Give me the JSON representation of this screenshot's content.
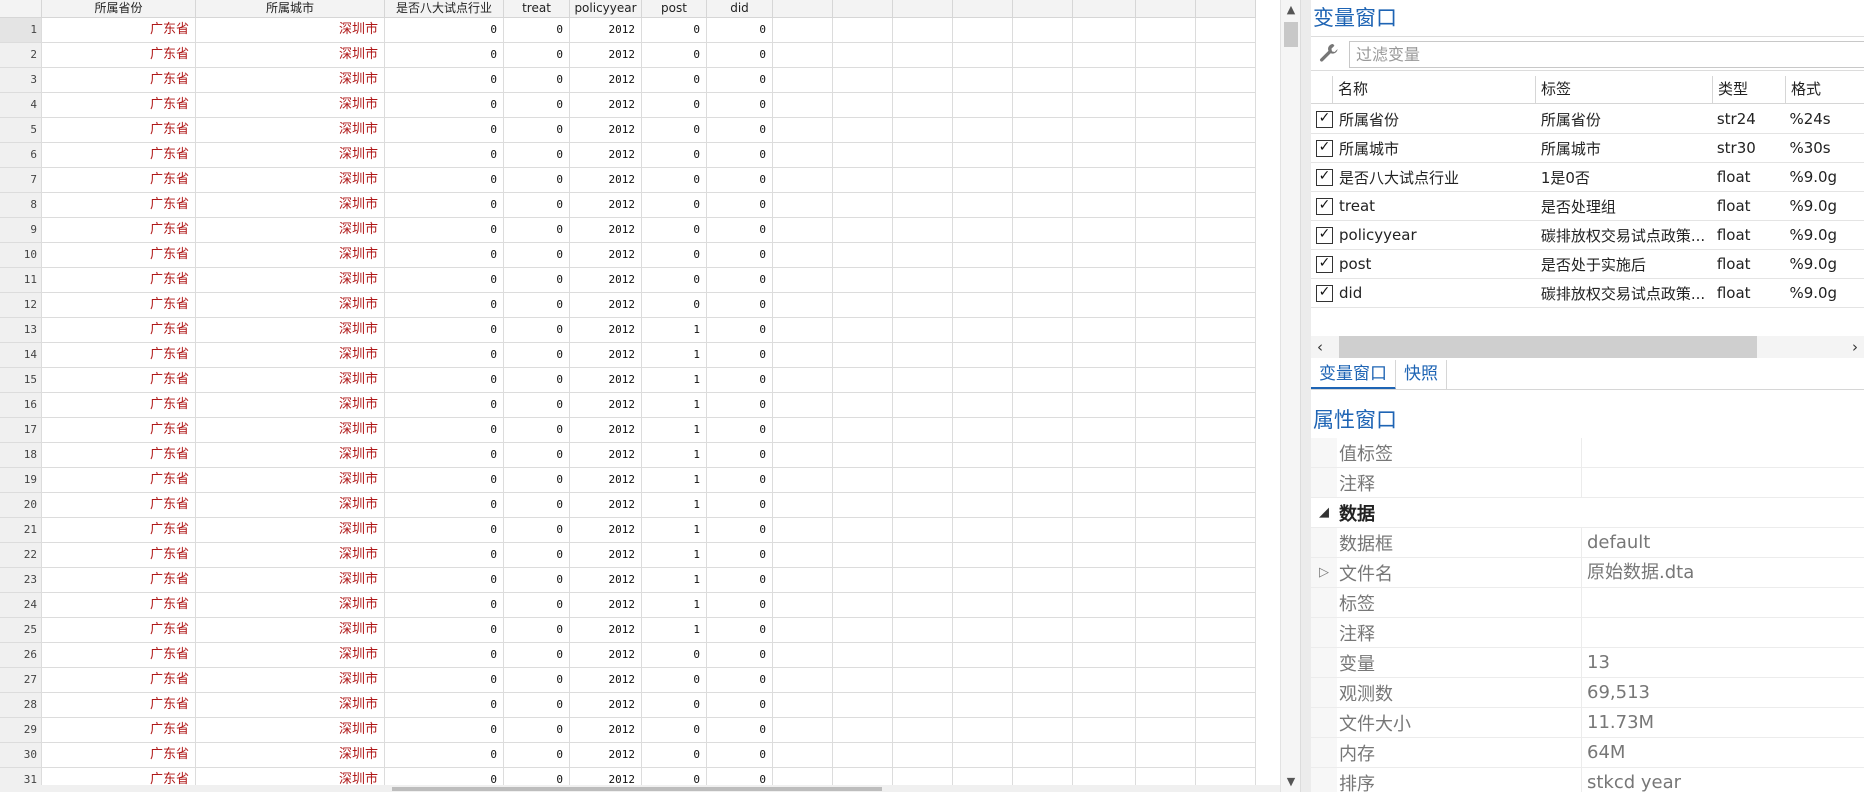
{
  "grid": {
    "columns": [
      {
        "label": "所属省份",
        "type": "str"
      },
      {
        "label": "所属城市",
        "type": "str"
      },
      {
        "label": "是否八大试点行业",
        "type": "num"
      },
      {
        "label": "treat",
        "type": "num"
      },
      {
        "label": "policyyear",
        "type": "num"
      },
      {
        "label": "post",
        "type": "num"
      },
      {
        "label": "did",
        "type": "num"
      }
    ],
    "rows": [
      [
        "1",
        "广东省",
        "深圳市",
        "0",
        "0",
        "2012",
        "0",
        "0"
      ],
      [
        "2",
        "广东省",
        "深圳市",
        "0",
        "0",
        "2012",
        "0",
        "0"
      ],
      [
        "3",
        "广东省",
        "深圳市",
        "0",
        "0",
        "2012",
        "0",
        "0"
      ],
      [
        "4",
        "广东省",
        "深圳市",
        "0",
        "0",
        "2012",
        "0",
        "0"
      ],
      [
        "5",
        "广东省",
        "深圳市",
        "0",
        "0",
        "2012",
        "0",
        "0"
      ],
      [
        "6",
        "广东省",
        "深圳市",
        "0",
        "0",
        "2012",
        "0",
        "0"
      ],
      [
        "7",
        "广东省",
        "深圳市",
        "0",
        "0",
        "2012",
        "0",
        "0"
      ],
      [
        "8",
        "广东省",
        "深圳市",
        "0",
        "0",
        "2012",
        "0",
        "0"
      ],
      [
        "9",
        "广东省",
        "深圳市",
        "0",
        "0",
        "2012",
        "0",
        "0"
      ],
      [
        "10",
        "广东省",
        "深圳市",
        "0",
        "0",
        "2012",
        "0",
        "0"
      ],
      [
        "11",
        "广东省",
        "深圳市",
        "0",
        "0",
        "2012",
        "0",
        "0"
      ],
      [
        "12",
        "广东省",
        "深圳市",
        "0",
        "0",
        "2012",
        "0",
        "0"
      ],
      [
        "13",
        "广东省",
        "深圳市",
        "0",
        "0",
        "2012",
        "1",
        "0"
      ],
      [
        "14",
        "广东省",
        "深圳市",
        "0",
        "0",
        "2012",
        "1",
        "0"
      ],
      [
        "15",
        "广东省",
        "深圳市",
        "0",
        "0",
        "2012",
        "1",
        "0"
      ],
      [
        "16",
        "广东省",
        "深圳市",
        "0",
        "0",
        "2012",
        "1",
        "0"
      ],
      [
        "17",
        "广东省",
        "深圳市",
        "0",
        "0",
        "2012",
        "1",
        "0"
      ],
      [
        "18",
        "广东省",
        "深圳市",
        "0",
        "0",
        "2012",
        "1",
        "0"
      ],
      [
        "19",
        "广东省",
        "深圳市",
        "0",
        "0",
        "2012",
        "1",
        "0"
      ],
      [
        "20",
        "广东省",
        "深圳市",
        "0",
        "0",
        "2012",
        "1",
        "0"
      ],
      [
        "21",
        "广东省",
        "深圳市",
        "0",
        "0",
        "2012",
        "1",
        "0"
      ],
      [
        "22",
        "广东省",
        "深圳市",
        "0",
        "0",
        "2012",
        "1",
        "0"
      ],
      [
        "23",
        "广东省",
        "深圳市",
        "0",
        "0",
        "2012",
        "1",
        "0"
      ],
      [
        "24",
        "广东省",
        "深圳市",
        "0",
        "0",
        "2012",
        "1",
        "0"
      ],
      [
        "25",
        "广东省",
        "深圳市",
        "0",
        "0",
        "2012",
        "1",
        "0"
      ],
      [
        "26",
        "广东省",
        "深圳市",
        "0",
        "0",
        "2012",
        "0",
        "0"
      ],
      [
        "27",
        "广东省",
        "深圳市",
        "0",
        "0",
        "2012",
        "0",
        "0"
      ],
      [
        "28",
        "广东省",
        "深圳市",
        "0",
        "0",
        "2012",
        "0",
        "0"
      ],
      [
        "29",
        "广东省",
        "深圳市",
        "0",
        "0",
        "2012",
        "0",
        "0"
      ],
      [
        "30",
        "广东省",
        "深圳市",
        "0",
        "0",
        "2012",
        "0",
        "0"
      ],
      [
        "31",
        "广东省",
        "深圳市",
        "0",
        "0",
        "2012",
        "0",
        "0"
      ]
    ],
    "colors": {
      "string_text": "#b01818",
      "number_text": "#111111"
    }
  },
  "variables_panel": {
    "title": "变量窗口",
    "filter_placeholder": "过滤变量",
    "headers": {
      "name": "名称",
      "label": "标签",
      "type": "类型",
      "format": "格式"
    },
    "items": [
      {
        "checked": true,
        "name": "所属省份",
        "label": "所属省份",
        "type": "str24",
        "format": "%24s"
      },
      {
        "checked": true,
        "name": "所属城市",
        "label": "所属城市",
        "type": "str30",
        "format": "%30s"
      },
      {
        "checked": true,
        "name": "是否八大试点行业",
        "label": "1是0否",
        "type": "float",
        "format": "%9.0g"
      },
      {
        "checked": true,
        "name": "treat",
        "label": "是否处理组",
        "type": "float",
        "format": "%9.0g"
      },
      {
        "checked": true,
        "name": "policyyear",
        "label": "碳排放权交易试点政策...",
        "type": "float",
        "format": "%9.0g"
      },
      {
        "checked": true,
        "name": "post",
        "label": "是否处于实施后",
        "type": "float",
        "format": "%9.0g"
      },
      {
        "checked": true,
        "name": "did",
        "label": "碳排放权交易试点政策...",
        "type": "float",
        "format": "%9.0g"
      }
    ],
    "tabs": [
      {
        "label": "变量窗口",
        "active": true
      },
      {
        "label": "快照",
        "active": false
      }
    ]
  },
  "properties_panel": {
    "title": "属性窗口",
    "rows": [
      {
        "kind": "prop",
        "key": "值标签",
        "value": ""
      },
      {
        "kind": "prop",
        "key": "注释",
        "value": ""
      },
      {
        "kind": "section",
        "key": "数据",
        "value": ""
      },
      {
        "kind": "prop",
        "key": "数据框",
        "value": "default"
      },
      {
        "kind": "prop",
        "key": "文件名",
        "value": "原始数据.dta",
        "expandable": true
      },
      {
        "kind": "prop",
        "key": "标签",
        "value": ""
      },
      {
        "kind": "prop",
        "key": "注释",
        "value": ""
      },
      {
        "kind": "prop",
        "key": "变量",
        "value": "13"
      },
      {
        "kind": "prop",
        "key": "观测数",
        "value": "69,513"
      },
      {
        "kind": "prop",
        "key": "文件大小",
        "value": "11.73M"
      },
      {
        "kind": "prop",
        "key": "内存",
        "value": "64M"
      },
      {
        "kind": "prop",
        "key": "排序",
        "value": "stkcd year"
      }
    ]
  },
  "accent_color": "#1e64b4"
}
